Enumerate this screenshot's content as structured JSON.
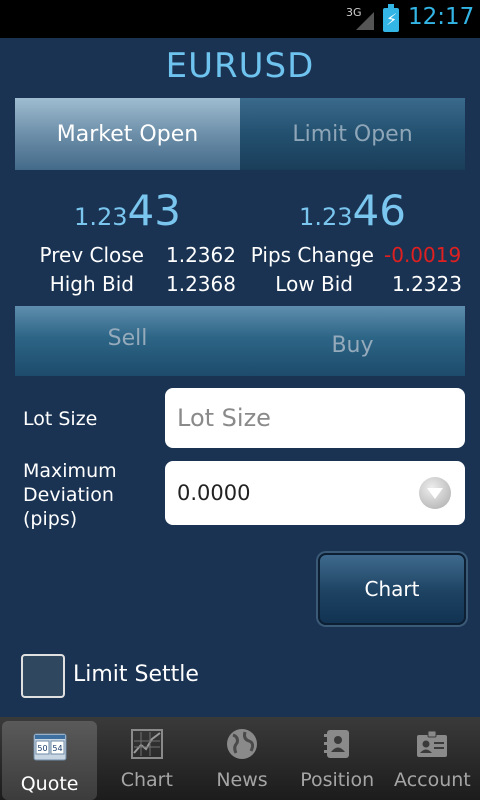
{
  "status_bar": {
    "network": "3G",
    "time": "12:17"
  },
  "title": "EURUSD",
  "tabs": [
    {
      "label": "Market Open",
      "active": true
    },
    {
      "label": "Limit Open",
      "active": false
    }
  ],
  "quotes": {
    "bid": {
      "prefix": "1.23",
      "pips": "43"
    },
    "ask": {
      "prefix": "1.23",
      "pips": "46"
    }
  },
  "stats": {
    "prev_close_label": "Prev Close",
    "prev_close": "1.2362",
    "pips_change_label": "Pips Change",
    "pips_change": "-0.0019",
    "high_bid_label": "High Bid",
    "high_bid": "1.2368",
    "low_bid_label": "Low Bid",
    "low_bid": "1.2323"
  },
  "trade": {
    "sell_label": "Sell",
    "buy_label": "Buy"
  },
  "form": {
    "lot_size_label": "Lot Size",
    "lot_size_placeholder": "Lot Size",
    "max_dev_label_line1": "Maximum",
    "max_dev_label_line2": "Deviation",
    "max_dev_label_line3": "(pips)",
    "max_dev_value": "0.0000"
  },
  "chart_button_label": "Chart",
  "limit_settle_label": "Limit Settle",
  "bottom_nav": [
    {
      "label": "Quote",
      "icon": "quote-icon",
      "active": true
    },
    {
      "label": "Chart",
      "icon": "chart-icon",
      "active": false
    },
    {
      "label": "News",
      "icon": "globe-icon",
      "active": false
    },
    {
      "label": "Position",
      "icon": "position-icon",
      "active": false
    },
    {
      "label": "Account",
      "icon": "account-icon",
      "active": false
    }
  ],
  "colors": {
    "background": "#1a3352",
    "title": "#6fc3ef",
    "negative": "#e02020"
  }
}
